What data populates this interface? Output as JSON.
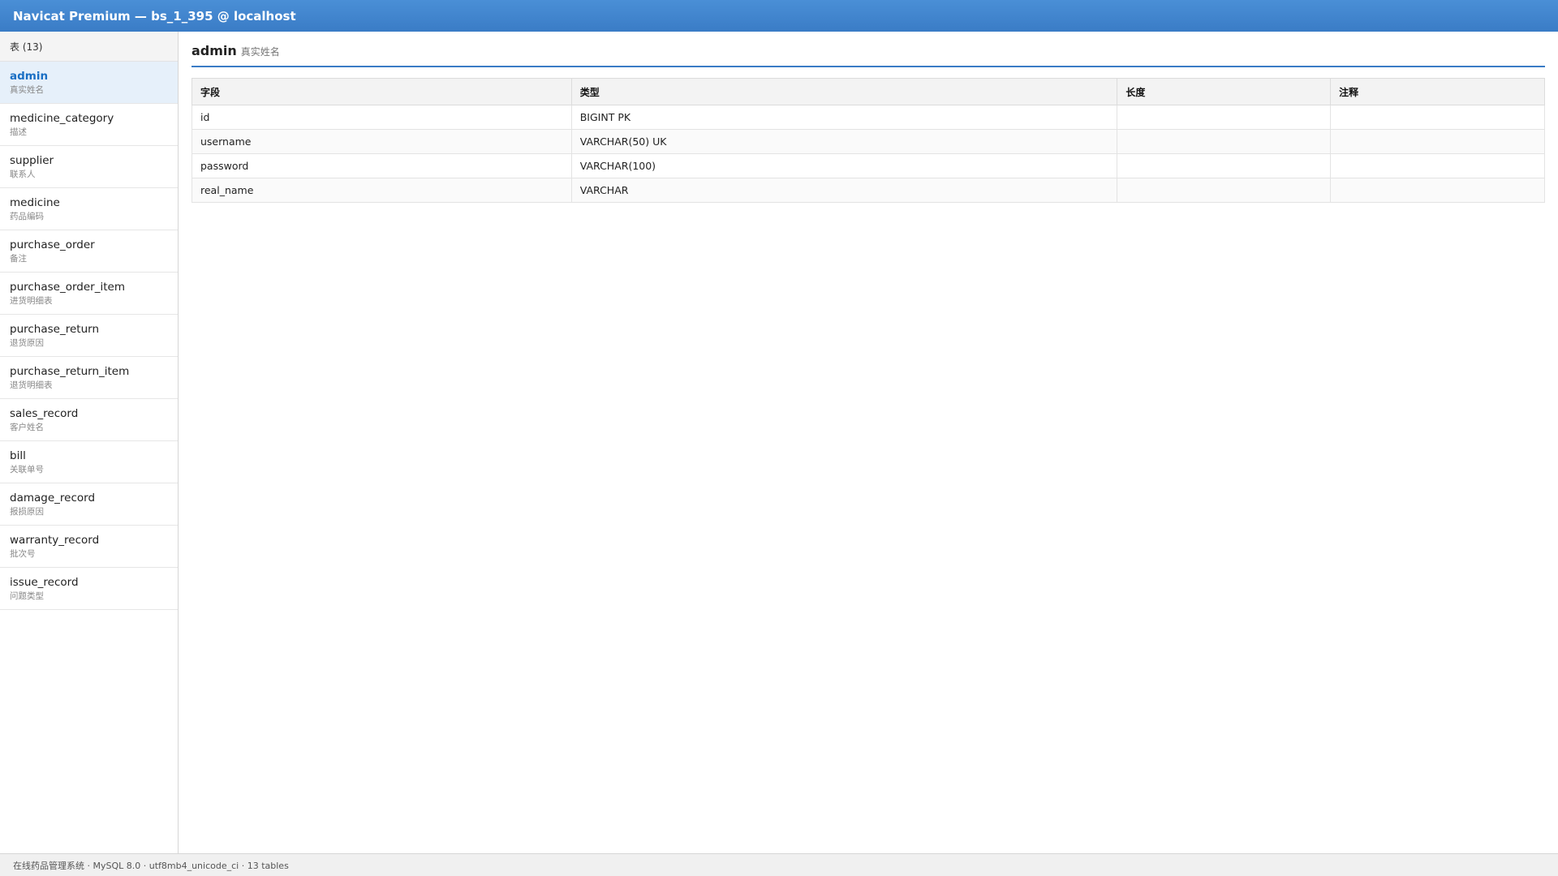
{
  "window": {
    "title": "Navicat Premium — bs_1_395 @ localhost"
  },
  "sidebar": {
    "header": "表 (13)",
    "items": [
      {
        "name": "admin",
        "comment": "真实姓名",
        "active": true
      },
      {
        "name": "medicine_category",
        "comment": "描述"
      },
      {
        "name": "supplier",
        "comment": "联系人"
      },
      {
        "name": "medicine",
        "comment": "药品编码"
      },
      {
        "name": "purchase_order",
        "comment": "备注"
      },
      {
        "name": "purchase_order_item",
        "comment": "进货明细表"
      },
      {
        "name": "purchase_return",
        "comment": "退货原因"
      },
      {
        "name": "purchase_return_item",
        "comment": "退货明细表"
      },
      {
        "name": "sales_record",
        "comment": "客户姓名"
      },
      {
        "name": "bill",
        "comment": "关联单号"
      },
      {
        "name": "damage_record",
        "comment": "报损原因"
      },
      {
        "name": "warranty_record",
        "comment": "批次号"
      },
      {
        "name": "issue_record",
        "comment": "问题类型"
      }
    ]
  },
  "main": {
    "table_name": "admin",
    "table_comment": "真实姓名",
    "columns": [
      "字段",
      "类型",
      "长度",
      "注释"
    ],
    "rows": [
      [
        "id",
        "BIGINT PK",
        "",
        ""
      ],
      [
        "username",
        "VARCHAR(50) UK",
        "",
        ""
      ],
      [
        "password",
        "VARCHAR(100)",
        "",
        ""
      ],
      [
        "real_name",
        "VARCHAR",
        "",
        ""
      ]
    ]
  },
  "statusbar": {
    "text": "在线药品管理系统 · MySQL 8.0 · utf8mb4_unicode_ci · 13 tables"
  }
}
